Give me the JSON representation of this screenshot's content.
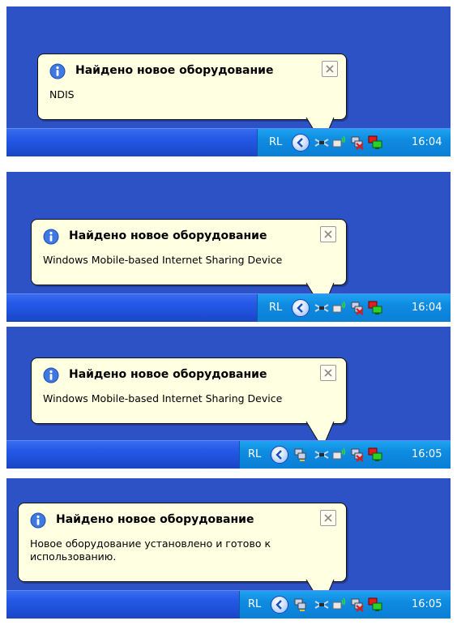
{
  "panels": [
    {
      "balloon": {
        "title": "Найдено новое оборудование",
        "message": "NDIS"
      },
      "taskbar": {
        "language": "RL",
        "time": "16:04"
      }
    },
    {
      "balloon": {
        "title": "Найдено новое оборудование",
        "message": "Windows Mobile-based Internet Sharing Device"
      },
      "taskbar": {
        "language": "RL",
        "time": "16:04"
      }
    },
    {
      "balloon": {
        "title": "Найдено новое оборудование",
        "message": "Windows Mobile-based Internet Sharing Device"
      },
      "taskbar": {
        "language": "RL",
        "time": "16:05"
      }
    },
    {
      "balloon": {
        "title": "Найдено новое оборудование",
        "message_line1": "Новое оборудование установлено и готово к",
        "message_line2": "использованию."
      },
      "taskbar": {
        "language": "RL",
        "time": "16:05"
      }
    }
  ],
  "icons": {
    "balloon_icon": "info-icon",
    "close_icon": "close-icon",
    "tray_expand": "chevron-left-icon",
    "network_connector": "network-connector-icon",
    "wireless": "wireless-signal-icon",
    "network_disconnected": "network-disconnected-icon",
    "network_connected": "network-connected-icon",
    "network_activity": "network-activity-icon"
  },
  "colors": {
    "desktop": "#2c52c6",
    "taskbar": "#2458e6",
    "tray": "#0e8be0",
    "balloon_bg": "#ffffe1"
  }
}
